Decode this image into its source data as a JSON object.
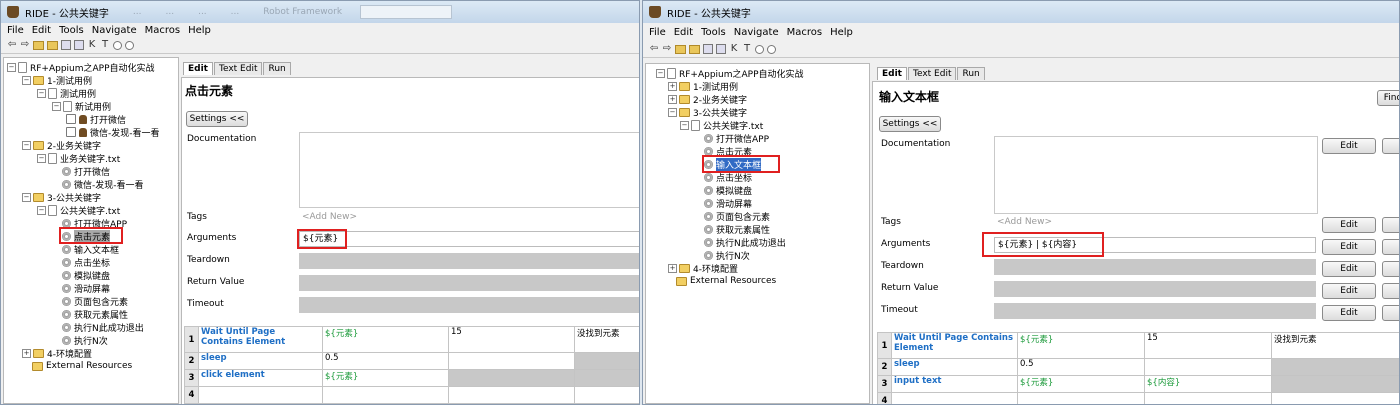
{
  "left_window": {
    "title": "RIDE - 公共关键字",
    "ghost_titles": [
      "...",
      "...",
      "...",
      "...",
      "Robot Framework"
    ],
    "menu": [
      "File",
      "Edit",
      "Tools",
      "Navigate",
      "Macros",
      "Help"
    ],
    "tree": [
      {
        "label": "RF+Appium之APP自动化实战",
        "icon": "file"
      },
      {
        "label": "1-测试用例",
        "icon": "folder"
      },
      {
        "label": "测试用例",
        "icon": "file"
      },
      {
        "label": "新试用例",
        "icon": "file"
      },
      {
        "label": "打开微信",
        "icon": "robot"
      },
      {
        "label": "微信-发现-看一看",
        "icon": "robot"
      },
      {
        "label": "2-业务关键字",
        "icon": "folder"
      },
      {
        "label": "业务关键字.txt",
        "icon": "file"
      },
      {
        "label": "打开微信",
        "icon": "gear"
      },
      {
        "label": "微信-发现-看一看",
        "icon": "gear"
      },
      {
        "label": "3-公共关键字",
        "icon": "folder"
      },
      {
        "label": "公共关键字.txt",
        "icon": "file"
      },
      {
        "label": "打开微信APP",
        "icon": "gear"
      },
      {
        "label": "点击元素",
        "icon": "gear"
      },
      {
        "label": "输入文本框",
        "icon": "gear"
      },
      {
        "label": "点击坐标",
        "icon": "gear"
      },
      {
        "label": "模拟键盘",
        "icon": "gear"
      },
      {
        "label": "滑动屏幕",
        "icon": "gear"
      },
      {
        "label": "页面包含元素",
        "icon": "gear"
      },
      {
        "label": "获取元素属性",
        "icon": "gear"
      },
      {
        "label": "执行N此成功退出",
        "icon": "gear"
      },
      {
        "label": "执行N次",
        "icon": "gear"
      },
      {
        "label": "4-环境配置",
        "icon": "folder"
      },
      {
        "label": "External Resources",
        "icon": "folder"
      }
    ],
    "tabs": [
      "Edit",
      "Text Edit",
      "Run"
    ],
    "keyword_name": "点击元素",
    "settings_button": "Settings <<",
    "labels": {
      "documentation": "Documentation",
      "tags": "Tags",
      "arguments": "Arguments",
      "teardown": "Teardown",
      "return_value": "Return Value",
      "timeout": "Timeout"
    },
    "tags_placeholder": "<Add New>",
    "arguments_value": "${元素}",
    "steps": [
      {
        "n": "1",
        "kw": "Wait Until Page Contains Element",
        "a1": "${元素}",
        "a2": "15",
        "a3": "没找到元素"
      },
      {
        "n": "2",
        "kw": "sleep",
        "a1": "0.5",
        "a2": "",
        "a3": ""
      },
      {
        "n": "3",
        "kw": "click element",
        "a1": "${元素}",
        "a2": "",
        "a3": ""
      },
      {
        "n": "4",
        "kw": "",
        "a1": "",
        "a2": "",
        "a3": ""
      }
    ]
  },
  "right_window": {
    "title": "RIDE - 公共关键字",
    "menu": [
      "File",
      "Edit",
      "Tools",
      "Navigate",
      "Macros",
      "Help"
    ],
    "tree": [
      {
        "label": "RF+Appium之APP自动化实战",
        "icon": "file"
      },
      {
        "label": "1-测试用例",
        "icon": "folder"
      },
      {
        "label": "2-业务关键字",
        "icon": "folder"
      },
      {
        "label": "3-公共关键字",
        "icon": "folder"
      },
      {
        "label": "公共关键字.txt",
        "icon": "file"
      },
      {
        "label": "打开微信APP",
        "icon": "gear"
      },
      {
        "label": "点击元素",
        "icon": "gear"
      },
      {
        "label": "输入文本框",
        "icon": "gear"
      },
      {
        "label": "点击坐标",
        "icon": "gear"
      },
      {
        "label": "模拟键盘",
        "icon": "gear"
      },
      {
        "label": "滑动屏幕",
        "icon": "gear"
      },
      {
        "label": "页面包含元素",
        "icon": "gear"
      },
      {
        "label": "获取元素属性",
        "icon": "gear"
      },
      {
        "label": "执行N此成功退出",
        "icon": "gear"
      },
      {
        "label": "执行N次",
        "icon": "gear"
      },
      {
        "label": "4-环境配置",
        "icon": "folder"
      },
      {
        "label": "External Resources",
        "icon": "folder"
      }
    ],
    "tabs": [
      "Edit",
      "Text Edit",
      "Run"
    ],
    "keyword_name": "输入文本框",
    "find_button": "Find",
    "settings_button": "Settings <<",
    "edit_label": "Edit",
    "labels": {
      "documentation": "Documentation",
      "tags": "Tags",
      "arguments": "Arguments",
      "teardown": "Teardown",
      "return_value": "Return Value",
      "timeout": "Timeout"
    },
    "tags_placeholder": "<Add New>",
    "arguments_value": "${元素} | ${内容}",
    "steps": [
      {
        "n": "1",
        "kw": "Wait Until Page Contains Element",
        "a1": "${元素}",
        "a2": "15",
        "a3": "没找到元素"
      },
      {
        "n": "2",
        "kw": "sleep",
        "a1": "0.5",
        "a2": "",
        "a3": ""
      },
      {
        "n": "3",
        "kw": "input text",
        "a1": "${元素}",
        "a2": "${内容}",
        "a3": ""
      },
      {
        "n": "4",
        "kw": "",
        "a1": "",
        "a2": "",
        "a3": ""
      }
    ]
  },
  "colors": {
    "keyword": "#1f6fc5",
    "variable": "#1b9a3a",
    "highlight": "#e02020",
    "selection": "#316ac5"
  }
}
